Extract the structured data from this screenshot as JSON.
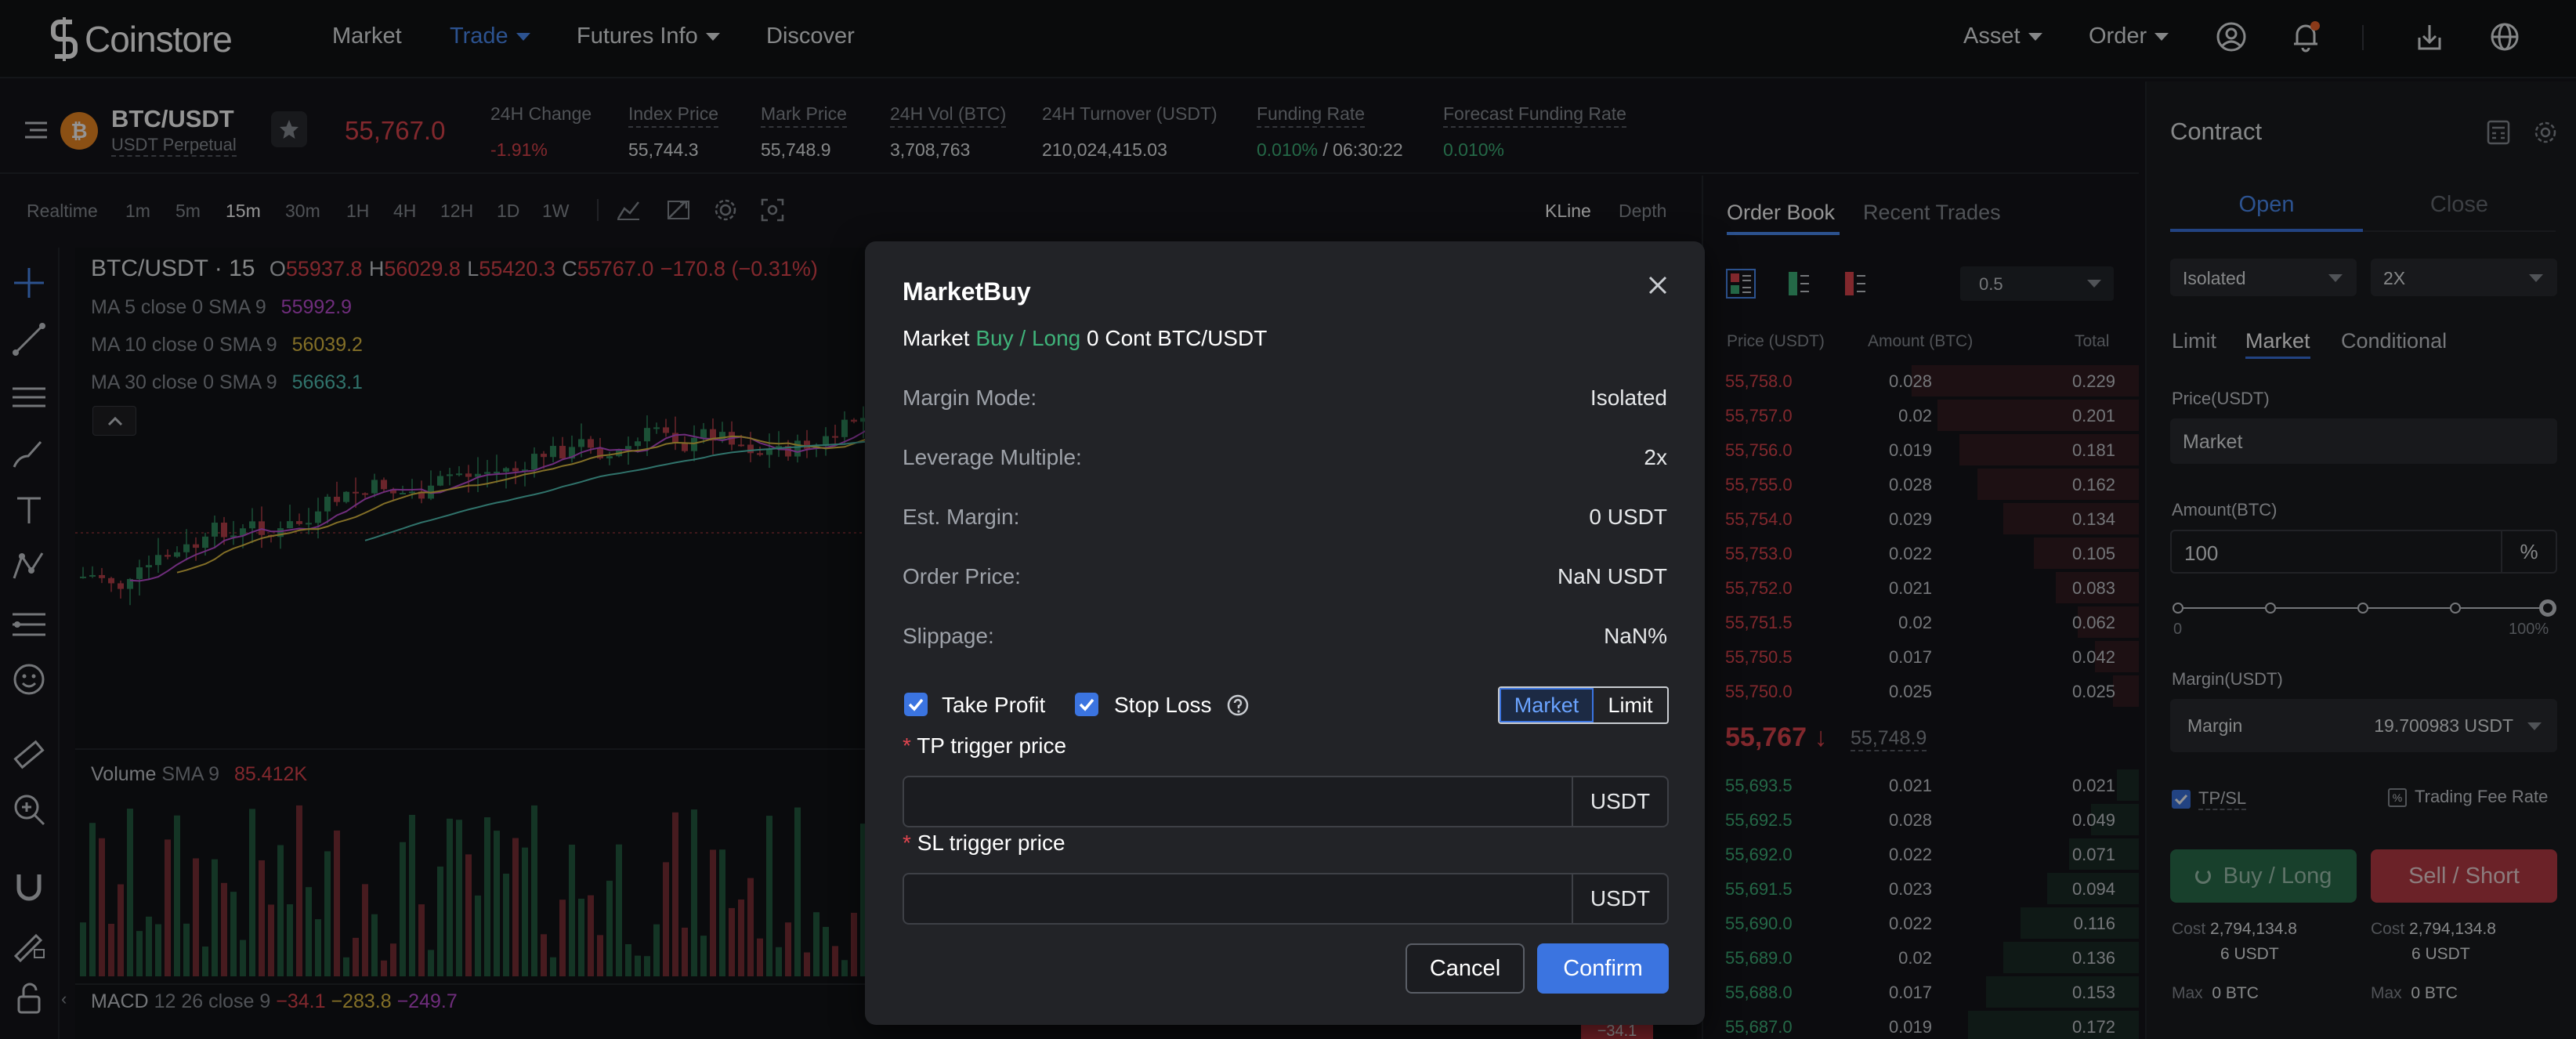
{
  "brand": {
    "name": "Coinstore"
  },
  "nav": {
    "items": [
      {
        "label": "Market"
      },
      {
        "label": "Trade"
      },
      {
        "label": "Futures Info"
      },
      {
        "label": "Discover"
      }
    ],
    "asset": "Asset",
    "order": "Order",
    "icons": [
      "user-icon",
      "bell-icon",
      "download-icon",
      "globe-icon"
    ]
  },
  "ticker": {
    "pair": "BTC/USDT",
    "type": "USDT Perpetual",
    "last_price": "55,767.0",
    "stats": [
      {
        "label": "24H Change",
        "value": "-1.91%"
      },
      {
        "label": "Index Price",
        "value": "55,744.3"
      },
      {
        "label": "Mark Price",
        "value": "55,748.9"
      },
      {
        "label": "24H Vol (BTC)",
        "value": "3,708,763"
      },
      {
        "label": "24H Turnover (USDT)",
        "value": "210,024,415.03"
      },
      {
        "label": "Funding Rate",
        "value": "0.010%",
        "value2": " / 06:30:22"
      },
      {
        "label": "Forecast Funding Rate",
        "value": "0.010%"
      }
    ]
  },
  "chart_toolbar": {
    "timeframes": [
      "Realtime",
      "1m",
      "5m",
      "15m",
      "30m",
      "1H",
      "4H",
      "12H",
      "1D",
      "1W"
    ],
    "selected": "15m",
    "views": [
      "KLine",
      "Depth"
    ]
  },
  "chart": {
    "title": "BTC/USDT · 15",
    "ohlc": {
      "o_label": "O",
      "o": "55937.8",
      "h_label": "H",
      "h": "56029.8",
      "l_label": "L",
      "l": "55420.3",
      "c_label": "C",
      "c": "55767.0",
      "chg": "−170.8 (−0.31%)"
    },
    "ma": [
      {
        "label": "MA 5 close 0 SMA 9",
        "value": "55992.9",
        "color": "#c04fd6"
      },
      {
        "label": "MA 10 close 0 SMA 9",
        "value": "56039.2",
        "color": "#e2c044"
      },
      {
        "label": "MA 30 close 0 SMA 9",
        "value": "56663.1",
        "color": "#53c6b8"
      }
    ],
    "volume": {
      "label": "Volume",
      "sma": "SMA 9",
      "value": "85.412K"
    },
    "macd": {
      "label": "MACD",
      "params": "12 26 close 9",
      "v1": "−34.1",
      "v2": "−283.8",
      "v3": "−249.7"
    },
    "macd_tag": "−34.1"
  },
  "orderbook": {
    "tabs": [
      "Order Book",
      "Recent Trades"
    ],
    "precision": "0.5",
    "headers": [
      "Price (USDT)",
      "Amount (BTC)",
      "Total"
    ],
    "asks": [
      {
        "price": "55,758.0",
        "amount": "0.028",
        "total": "0.229",
        "depth": 0.52
      },
      {
        "price": "55,757.0",
        "amount": "0.02",
        "total": "0.201",
        "depth": 0.46
      },
      {
        "price": "55,756.0",
        "amount": "0.019",
        "total": "0.181",
        "depth": 0.41
      },
      {
        "price": "55,755.0",
        "amount": "0.028",
        "total": "0.162",
        "depth": 0.37
      },
      {
        "price": "55,754.0",
        "amount": "0.029",
        "total": "0.134",
        "depth": 0.31
      },
      {
        "price": "55,753.0",
        "amount": "0.022",
        "total": "0.105",
        "depth": 0.24
      },
      {
        "price": "55,752.0",
        "amount": "0.021",
        "total": "0.083",
        "depth": 0.19
      },
      {
        "price": "55,751.5",
        "amount": "0.02",
        "total": "0.062",
        "depth": 0.14
      },
      {
        "price": "55,750.5",
        "amount": "0.017",
        "total": "0.042",
        "depth": 0.1
      },
      {
        "price": "55,750.0",
        "amount": "0.025",
        "total": "0.025",
        "depth": 0.06
      }
    ],
    "mid_price": "55,767",
    "mark_price": "55,748.9",
    "bids": [
      {
        "price": "55,693.5",
        "amount": "0.021",
        "total": "0.021",
        "depth": 0.05
      },
      {
        "price": "55,692.5",
        "amount": "0.028",
        "total": "0.049",
        "depth": 0.11
      },
      {
        "price": "55,692.0",
        "amount": "0.022",
        "total": "0.071",
        "depth": 0.16
      },
      {
        "price": "55,691.5",
        "amount": "0.023",
        "total": "0.094",
        "depth": 0.21
      },
      {
        "price": "55,690.0",
        "amount": "0.022",
        "total": "0.116",
        "depth": 0.27
      },
      {
        "price": "55,689.0",
        "amount": "0.02",
        "total": "0.136",
        "depth": 0.31
      },
      {
        "price": "55,688.0",
        "amount": "0.017",
        "total": "0.153",
        "depth": 0.35
      },
      {
        "price": "55,687.0",
        "amount": "0.019",
        "total": "0.172",
        "depth": 0.39
      }
    ]
  },
  "contract": {
    "title": "Contract",
    "tabs": [
      "Open",
      "Close"
    ],
    "margin_mode": "Isolated",
    "leverage": "2X",
    "order_types": [
      "Limit",
      "Market",
      "Conditional"
    ],
    "price_label": "Price(USDT)",
    "price_value": "Market",
    "amount_label": "Amount(BTC)",
    "amount_value": "100",
    "amount_unit": "%",
    "slider_min": "0",
    "slider_max": "100%",
    "slider_value": 1.0,
    "margin_label": "Margin(USDT)",
    "margin_select": "Margin",
    "margin_value": "19.700983 USDT",
    "tpsl": "TP/SL",
    "fee": "Trading Fee Rate",
    "buy_label": "Buy / Long",
    "sell_label": "Sell / Short",
    "cost_label": "Cost",
    "buy_cost": "2,794,134.8",
    "buy_cost2": "6 USDT",
    "sell_cost": "2,794,134.8",
    "sell_cost2": "6 USDT",
    "max_label": "Max",
    "buy_max": "0 BTC",
    "sell_max": "0 BTC"
  },
  "modal": {
    "title": "MarketBuy",
    "sub_market": "Market",
    "sub_side": "Buy / Long",
    "sub_rest": "0 Cont BTC/USDT",
    "rows": [
      {
        "label": "Margin Mode:",
        "value": "Isolated"
      },
      {
        "label": "Leverage Multiple:",
        "value": "2x"
      },
      {
        "label": "Est. Margin:",
        "value": "0 USDT"
      },
      {
        "label": "Order Price:",
        "value": "NaN USDT"
      },
      {
        "label": "Slippage:",
        "value": "NaN%"
      }
    ],
    "take_profit": "Take Profit",
    "stop_loss": "Stop Loss",
    "toggle": [
      "Market",
      "Limit"
    ],
    "tp_label": "TP trigger price",
    "sl_label": "SL trigger price",
    "unit": "USDT",
    "required": "*",
    "cancel": "Cancel",
    "confirm": "Confirm"
  },
  "colors": {
    "up": "#3fb37a",
    "down": "#e0454f",
    "accent": "#3b74e0"
  }
}
